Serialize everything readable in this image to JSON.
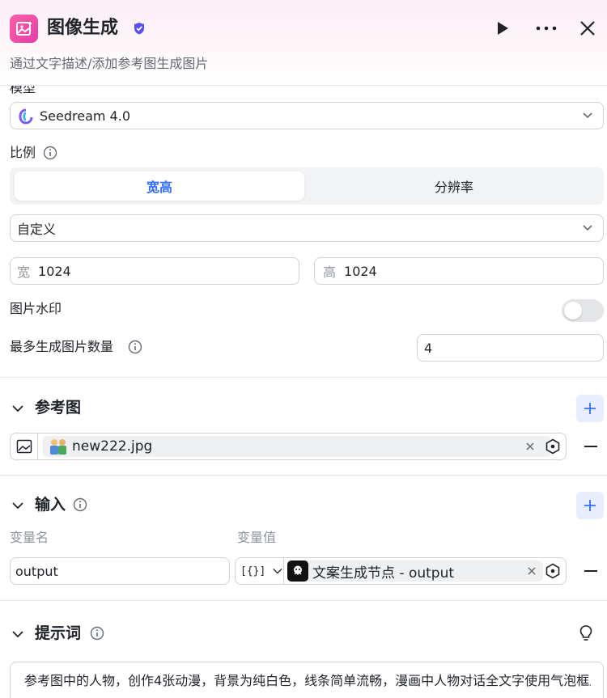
{
  "header": {
    "title": "图像生成",
    "subtitle": "通过文字描述/添加参考图生成图片"
  },
  "model": {
    "label": "模型",
    "value": "Seedream 4.0"
  },
  "ratio": {
    "label": "比例",
    "tabs": [
      "宽高",
      "分辨率"
    ],
    "active_tab": "宽高",
    "preset": "自定义",
    "width_prefix": "宽",
    "width": "1024",
    "height_prefix": "高",
    "height": "1024"
  },
  "watermark": {
    "label": "图片水印",
    "enabled": false
  },
  "count": {
    "label": "最多生成图片数量",
    "value": "4"
  },
  "reference": {
    "title": "参考图",
    "file": "new222.jpg"
  },
  "inputs": {
    "title": "输入",
    "col_name": "变量名",
    "col_value": "变量值",
    "var_name": "output",
    "type_icon": "[{}]",
    "var_value": "文案生成节点 - output"
  },
  "prompt": {
    "title": "提示词",
    "text": "参考图中的人物，创作4张动漫，背景为纯白色，线条简单流畅，漫画中人物对话全文字使用气泡框显示"
  },
  "colors": {
    "accent": "#3370ff",
    "brand_pink": "#e03ea8"
  }
}
